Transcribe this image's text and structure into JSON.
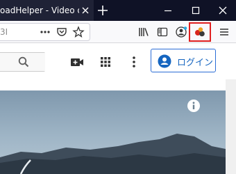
{
  "tab": {
    "title": "oadHelper - Video down"
  },
  "window_controls": [
    "minimize",
    "maximize",
    "close"
  ],
  "urlbar": {
    "text": "3I"
  },
  "toolbar_icons": [
    "more-dots-icon",
    "pocket-icon",
    "bookmark-star-icon",
    "library-icon",
    "reader-sidebar-icon",
    "account-icon",
    "video-downloadhelper-extension-icon",
    "hamburger-menu-icon"
  ],
  "page_header": {
    "login_label": "ログイン"
  },
  "colors": {
    "tabbar_bg": "#0f1226",
    "active_tab_bg": "#1f2236",
    "toolbar_bg": "#f9f9fb",
    "highlight_border": "#e02020",
    "login_blue": "#1565c0"
  }
}
